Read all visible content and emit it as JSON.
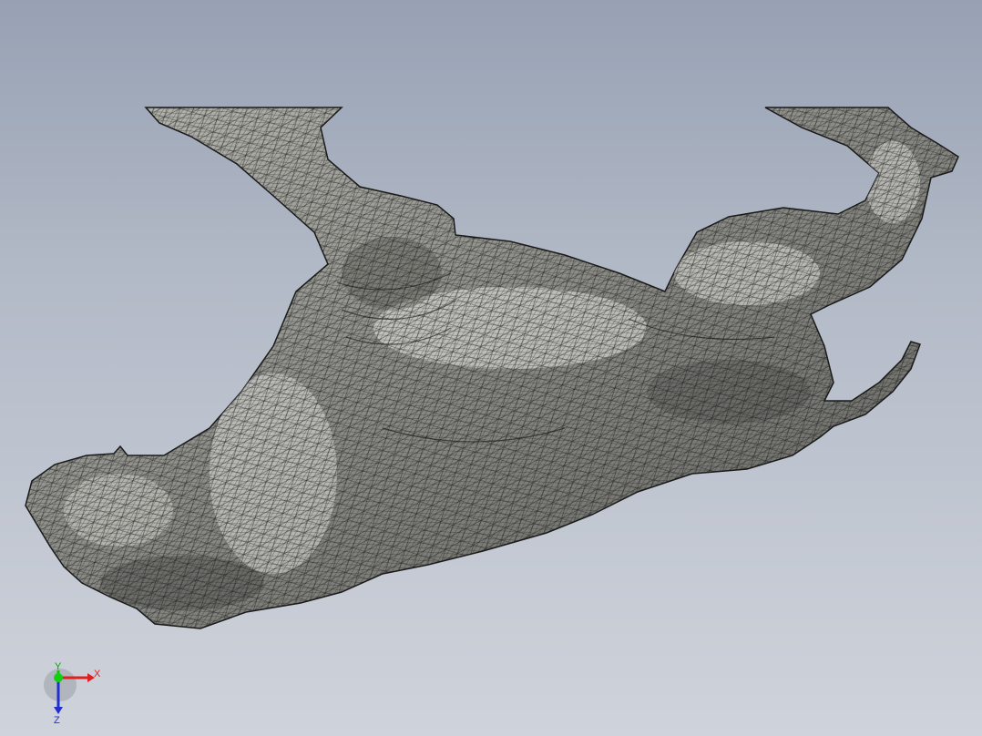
{
  "viewport": {
    "background_top": "#97a1b3",
    "background_bottom": "#cfd3db",
    "model": {
      "description_name": "rhino-mesh",
      "fill": "#8f8f8a",
      "highlight": "#f4f4ee",
      "edge": "#1a1a1a"
    }
  },
  "triad": {
    "x_label": "X",
    "y_label": "Y",
    "z_label": "Z",
    "x_color": "#e02020",
    "y_color": "#10c010",
    "z_color": "#2030d0"
  }
}
